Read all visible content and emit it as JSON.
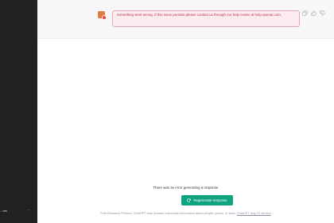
{
  "sidebar": {
    "user_label": "...ors",
    "menu_icon": "ellipsis-icon"
  },
  "conversation": {
    "error_message": "Something went wrong. If this issue persists please contact us through our help center at help.openai.com.",
    "avatar_color": "#e07a3f",
    "actions": [
      "copy-icon",
      "thumbs-up-icon",
      "thumbs-down-icon"
    ]
  },
  "bottom": {
    "status_text": "There was an error generating a response",
    "regenerate_label": "Regenerate response",
    "footer_text": "Free Research Preview. ChatGPT may produce inaccurate information about people, places, or facts.",
    "footer_link": "ChatGPT May 24 Version"
  },
  "colors": {
    "sidebar_bg": "#202123",
    "accent": "#10a37f",
    "error_border": "#e7a6b0",
    "error_bg": "#fcecef",
    "error_text": "#b4374c"
  }
}
